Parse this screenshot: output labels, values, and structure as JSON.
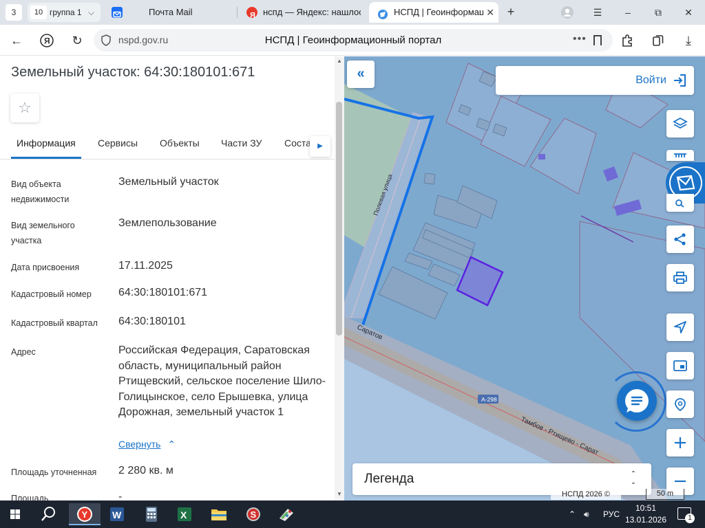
{
  "browser": {
    "tab_counter": "3",
    "tab_group": {
      "count": "10",
      "label": "группа 1"
    },
    "tabs": [
      {
        "title": "Почта Mail"
      },
      {
        "title": "нспд — Яндекс: нашлось"
      },
      {
        "title": "НСПД | Геоинформацио"
      }
    ],
    "url_domain": "nspd.gov.ru",
    "page_title": "НСПД | Геоинформационный портал"
  },
  "panel": {
    "title": "Земельный участок: 64:30:180101:671",
    "tabs": [
      "Информация",
      "Сервисы",
      "Объекты",
      "Части ЗУ",
      "Соста…"
    ],
    "fields": [
      {
        "label": "Вид объекта недвижимости",
        "value": "Земельный участок"
      },
      {
        "label": "Вид земельного участка",
        "value": "Землепользование"
      },
      {
        "label": "Дата присвоения",
        "value": "17.11.2025"
      },
      {
        "label": "Кадастровый номер",
        "value": "64:30:180101:671"
      },
      {
        "label": "Кадастровый квартал",
        "value": "64:30:180101"
      },
      {
        "label": "Адрес",
        "value": "Российская Федерация, Саратовская область, муниципальный район Ртищевский, сельское поселение Шило-Голицынское, село Ерышевка, улица Дорожная, земельный участок 1"
      },
      {
        "label": "Площадь уточненная",
        "value": "2 280 кв. м"
      },
      {
        "label": "Площадь",
        "value": "-"
      }
    ],
    "collapse_label": "Свернуть"
  },
  "map": {
    "login_label": "Войти",
    "legend_label": "Легенда",
    "copyright": "НСПД 2026 ©",
    "scale": "50 m",
    "street_labels": {
      "polevaya": "Полевая улица",
      "saratov": "Саратов",
      "road_code": "А-298",
      "tambov": "Тамбов - Ртищево - Сарат"
    }
  },
  "taskbar": {
    "lang": "РУС",
    "time": "10:51",
    "date": "13.01.2026",
    "notifications": "1"
  },
  "colors": {
    "accent": "#1a73c8",
    "map_bg": "#7ea9cf",
    "selected_parcel": "#6f3fd8"
  }
}
